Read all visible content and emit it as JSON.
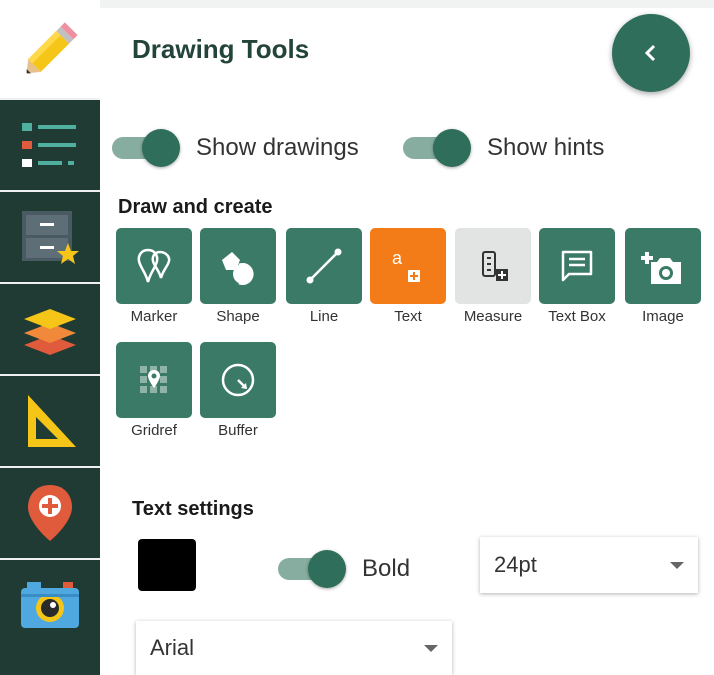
{
  "header": {
    "title": "Drawing Tools"
  },
  "toggles": [
    {
      "label": "Show drawings",
      "on": true
    },
    {
      "label": "Show hints",
      "on": true
    }
  ],
  "draw_section": {
    "title": "Draw and create",
    "tools": [
      {
        "label": "Marker",
        "icon": "marker-icon",
        "state": "normal"
      },
      {
        "label": "Shape",
        "icon": "shape-icon",
        "state": "normal"
      },
      {
        "label": "Line",
        "icon": "line-icon",
        "state": "normal"
      },
      {
        "label": "Text",
        "icon": "text-icon",
        "state": "active"
      },
      {
        "label": "Measure",
        "icon": "measure-icon",
        "state": "disabled"
      },
      {
        "label": "Text Box",
        "icon": "text-box-icon",
        "state": "normal"
      },
      {
        "label": "Image",
        "icon": "add-photo-icon",
        "state": "normal"
      },
      {
        "label": "Gridref",
        "icon": "gridref-icon",
        "state": "normal"
      },
      {
        "label": "Buffer",
        "icon": "buffer-icon",
        "state": "normal"
      }
    ]
  },
  "text_settings": {
    "title": "Text settings",
    "color": "#000000",
    "bold_label": "Bold",
    "bold_on": true,
    "size_value": "24pt",
    "font_value": "Arial"
  },
  "text_tool_glyph": "a",
  "colors": {
    "primary": "#3b7a66",
    "primary_dark": "#2f6e5b",
    "active": "#f47c18",
    "rail": "#1f3b33"
  }
}
